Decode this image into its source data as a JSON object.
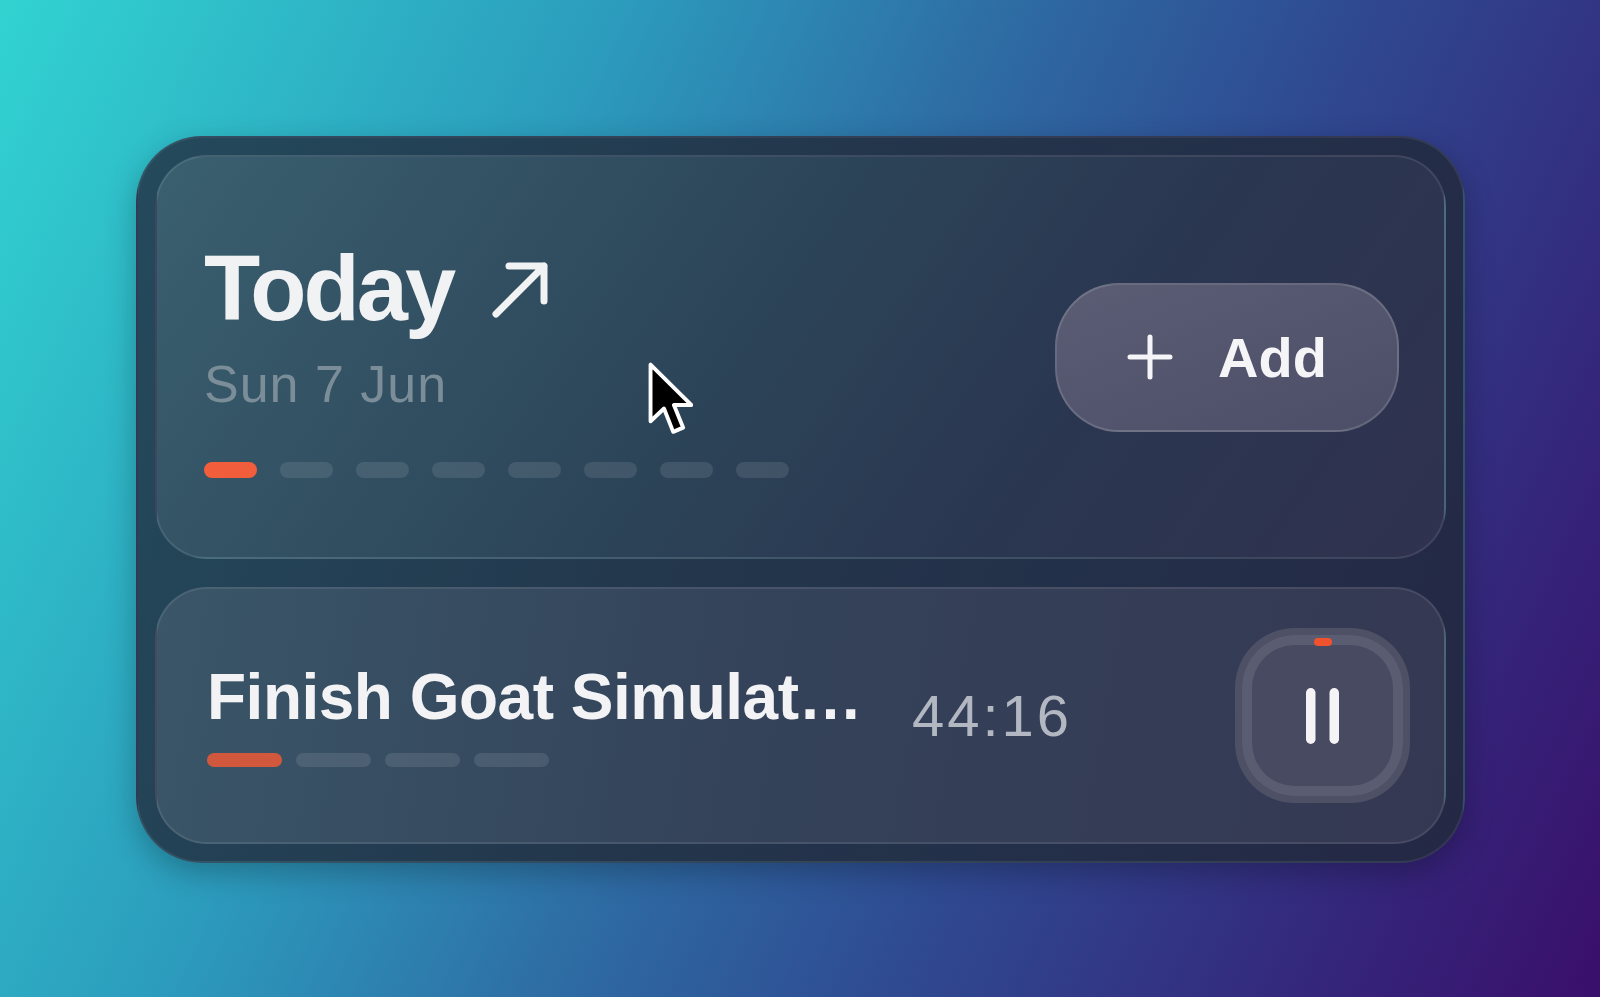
{
  "today_card": {
    "title": "Today",
    "date": "Sun 7 Jun",
    "segments": [
      {
        "filled": true
      },
      {
        "filled": false
      },
      {
        "filled": false
      },
      {
        "filled": false
      },
      {
        "filled": false
      },
      {
        "filled": false
      },
      {
        "filled": false
      },
      {
        "filled": false
      }
    ],
    "add_button": {
      "label": "Add"
    }
  },
  "task_card": {
    "title": "Finish Goat Simulat…",
    "timer": "44:16",
    "segments": [
      {
        "filled": true
      },
      {
        "filled": false
      },
      {
        "filled": false
      },
      {
        "filled": false
      }
    ],
    "running": true
  }
}
